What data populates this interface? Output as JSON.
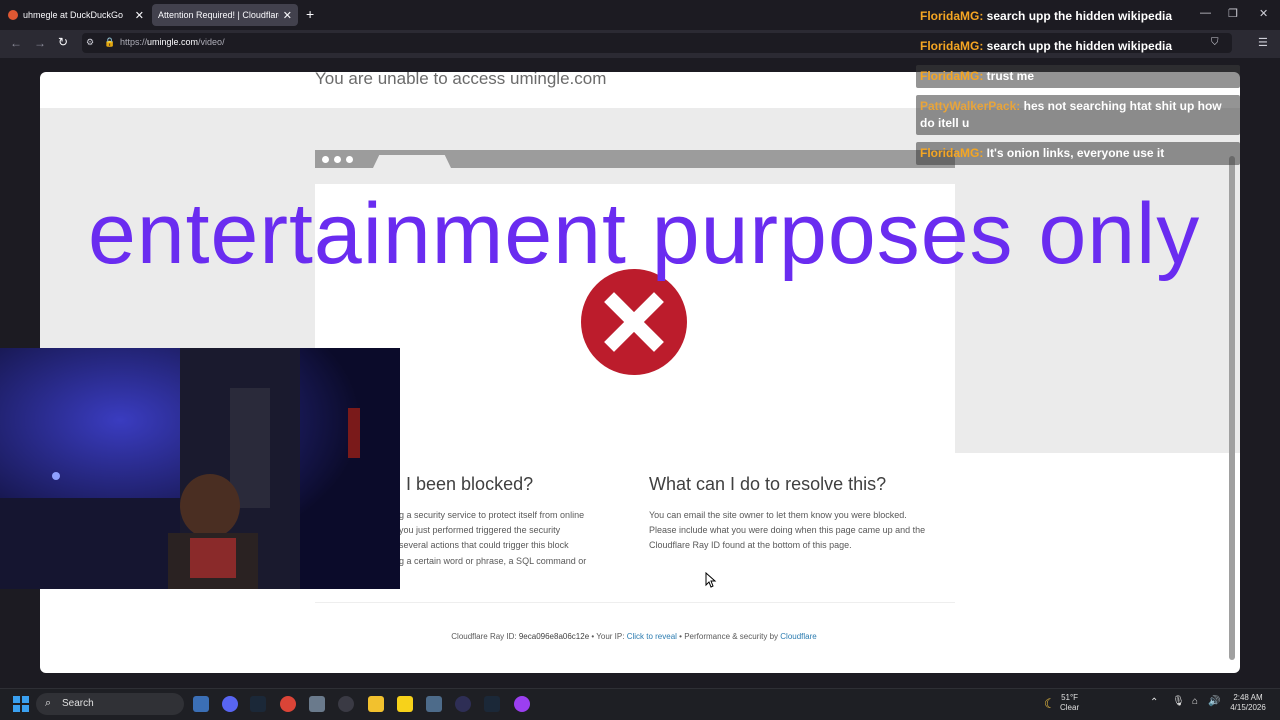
{
  "tabs": [
    {
      "title": "uhmegle at DuckDuckGo",
      "active": false
    },
    {
      "title": "Attention Required! | Cloudflare",
      "active": true
    }
  ],
  "address_bar": {
    "prefix": "https://",
    "host": "umingle.com",
    "path": "/video/"
  },
  "page": {
    "header": "You are unable to access umingle.com",
    "blocked_heading": "I been blocked?",
    "blocked_lines": [
      "g a security service to protect itself from online",
      "you just performed triggered the security",
      "several actions that could trigger this block",
      "g a certain word or phrase, a SQL command or"
    ],
    "resolve_heading": "What can I do to resolve this?",
    "resolve_lines": [
      "You can email the site owner to let them know you were blocked.",
      "Please include what you were doing when this page came up and the",
      "Cloudflare Ray ID found at the bottom of this page."
    ],
    "footer": {
      "ray_label": "Cloudflare Ray ID:",
      "ray_id": "9eca096e8a06c12e",
      "sep": "•",
      "ip_label": "Your IP:",
      "ip_link": "Click to reveal",
      "perf_label": "Performance & security by",
      "perf_link": "Cloudflare"
    }
  },
  "overlay_text": "entertainment purposes only",
  "chat": [
    {
      "user": "FloridaMG:",
      "text": "search upp the hidden wikipedia"
    },
    {
      "user": "FloridaMG:",
      "text": "search upp the hidden wikipedia"
    },
    {
      "user": "FloridaMG:",
      "text": "trust me"
    },
    {
      "user": "PattyWalkerPack:",
      "text": "hes not searching htat shit up how do itell u"
    },
    {
      "user": "FloridaMG:",
      "text": "It's onion links, everyone use it"
    }
  ],
  "taskbar": {
    "search_label": "Search",
    "weather_temp": "51°F",
    "weather_desc": "Clear",
    "time": "2:48 AM",
    "date": "4/15/2026"
  },
  "colors": {
    "overlay": "#6a2cf0",
    "error_red": "#bc1c2c",
    "link": "#2c7cb0",
    "chat_user": "#f5a623"
  }
}
